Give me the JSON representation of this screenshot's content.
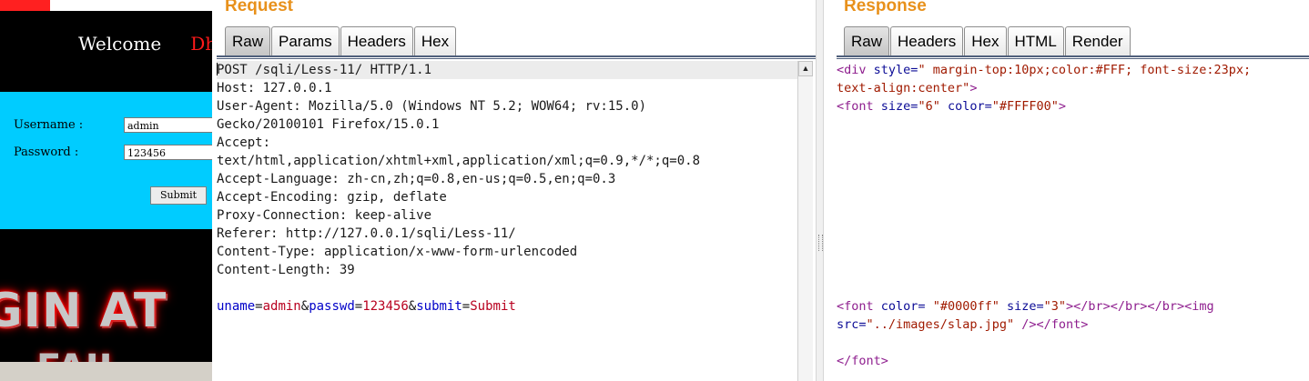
{
  "webpage": {
    "welcome": "Welcome",
    "welcome_name": "Dh",
    "username_label": "Username :",
    "username_value": "admin",
    "password_label": "Password :",
    "password_value": "123456",
    "submit_label": "Submit",
    "banner_text": "GIN AT",
    "banner_text2": "FAIL"
  },
  "request": {
    "title": "Request",
    "tabs": [
      {
        "label": "Raw",
        "active": true
      },
      {
        "label": "Params",
        "active": false
      },
      {
        "label": "Headers",
        "active": false
      },
      {
        "label": "Hex",
        "active": false
      }
    ],
    "lines": [
      "POST /sqli/Less-11/ HTTP/1.1",
      "Host: 127.0.0.1",
      "User-Agent: Mozilla/5.0 (Windows NT 5.2; WOW64; rv:15.0)",
      "Gecko/20100101 Firefox/15.0.1",
      "Accept:",
      "text/html,application/xhtml+xml,application/xml;q=0.9,*/*;q=0.8",
      "Accept-Language: zh-cn,zh;q=0.8,en-us;q=0.5,en;q=0.3",
      "Accept-Encoding: gzip, deflate",
      "Proxy-Connection: keep-alive",
      "Referer: http://127.0.0.1/sqli/Less-11/",
      "Content-Type: application/x-www-form-urlencoded",
      "Content-Length: 39"
    ],
    "body_params": [
      {
        "name": "uname",
        "value": "admin"
      },
      {
        "name": "passwd",
        "value": "123456"
      },
      {
        "name": "submit",
        "value": "Submit"
      }
    ]
  },
  "response": {
    "title": "Response",
    "tabs": [
      {
        "label": "Raw",
        "active": true
      },
      {
        "label": "Headers",
        "active": false
      },
      {
        "label": "Hex",
        "active": false
      },
      {
        "label": "HTML",
        "active": false
      },
      {
        "label": "Render",
        "active": false
      }
    ],
    "line1": {
      "tag": "<div",
      "attr": "style",
      "eq": "=",
      "val": "\" margin-top:10px;color:#FFF; font-size:23px;"
    },
    "line2": {
      "val": "text-align:center\"",
      "close": ">"
    },
    "line3": {
      "tag": "<font",
      "attr1": "size",
      "val1": "\"6\"",
      "attr2": "color",
      "val2": "\"#FFFF00\"",
      "close": ">"
    },
    "line4": {
      "tag": "<font",
      "attr1": "color",
      "val1": "\"#0000ff\"",
      "attr2": "size",
      "val2": "\"3\"",
      "rest": "></br></br></br><img"
    },
    "line5": {
      "attr": "src",
      "val": "\"../images/slap.jpg\"",
      "rest": " /></font>"
    },
    "line6": {
      "tag": "</font>"
    }
  },
  "colors": {
    "title_orange": "#e8911c",
    "param_name": "#0000c8",
    "param_value": "#b8001f",
    "tag": "#8e1e8e",
    "attr": "#0b0b96",
    "value": "#a01a00"
  }
}
